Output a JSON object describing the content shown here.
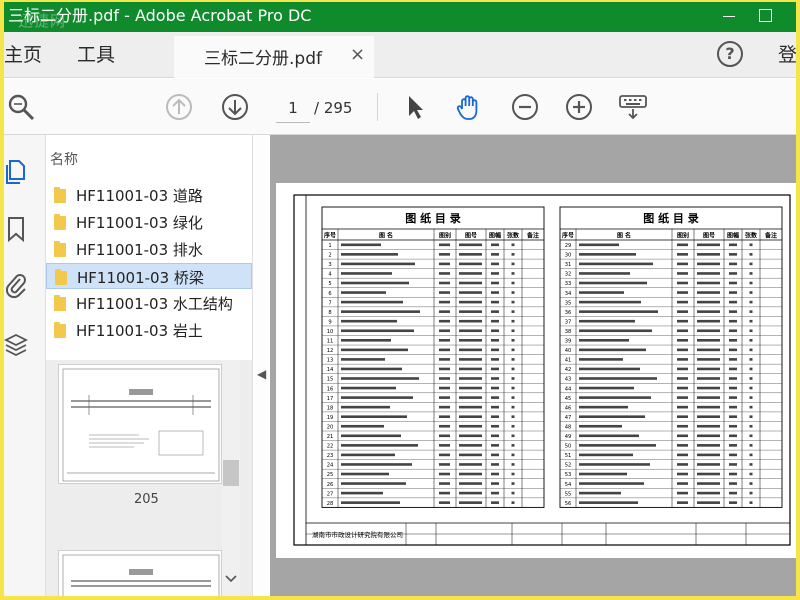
{
  "window": {
    "title": "三标二分册.pdf - Adobe Acrobat Pro DC",
    "watermark": "迅捷网"
  },
  "menubar": {
    "home": "主页",
    "tools": "工具",
    "document_tab": "三标二分册.pdf",
    "close_tab": "×",
    "help": "?",
    "signin": "登"
  },
  "toolbar": {
    "current_page": "1",
    "total_pages": "/ 295",
    "icons": [
      "search-icon",
      "page-up-icon",
      "page-down-icon",
      "select-cursor-icon",
      "hand-icon",
      "zoom-out-icon",
      "zoom-in-icon",
      "keyboard-icon"
    ],
    "accent_color": "#1a66d6"
  },
  "bookmarks": {
    "header": "名称",
    "items": [
      {
        "label": "HF11001-03 道路"
      },
      {
        "label": "HF11001-03 绿化"
      },
      {
        "label": "HF11001-03 排水"
      },
      {
        "label": "HF11001-03 桥梁",
        "selected": true
      },
      {
        "label": "HF11001-03 水工结构"
      },
      {
        "label": "HF11001-03 岩土"
      }
    ]
  },
  "thumbnails": {
    "first_page_number": "205"
  },
  "document": {
    "left_table_title": "图 纸 目 录",
    "right_table_title": "图 纸 目 录",
    "columns": [
      "序号",
      "图 名",
      "图别",
      "图号",
      "图幅",
      "张数",
      "备注"
    ],
    "left_row_numbers": [
      "1",
      "2",
      "3",
      "4",
      "5",
      "6",
      "7",
      "8",
      "9",
      "10",
      "11",
      "12",
      "13",
      "14",
      "15",
      "16",
      "17",
      "18",
      "19",
      "20",
      "21",
      "22",
      "23",
      "24",
      "25",
      "26",
      "27",
      "28"
    ],
    "right_row_numbers": [
      "29",
      "30",
      "31",
      "32",
      "33",
      "34",
      "35",
      "36",
      "37",
      "38",
      "39",
      "40",
      "41",
      "42",
      "43",
      "44",
      "45",
      "46",
      "47",
      "48",
      "49",
      "50",
      "51",
      "52",
      "53",
      "54",
      "55",
      "56"
    ],
    "title_block_company": "湖南市市政设计研究院有限公司"
  },
  "colors": {
    "titlebar": "#0f8b2c",
    "screen_border": "#f4e64a",
    "viewer_bg": "#a5a5a5",
    "selected_bookmark": "#cfe2f8"
  }
}
